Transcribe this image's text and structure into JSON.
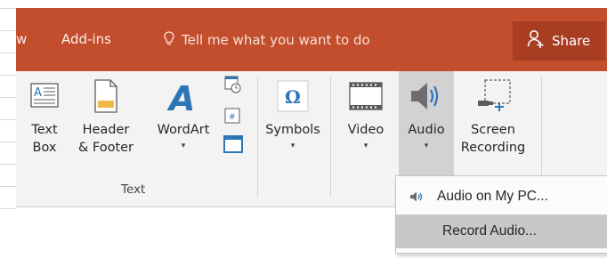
{
  "tabs": {
    "partial_tab": "w",
    "addins": "Add-ins",
    "tell_me": "Tell me what you want to do",
    "share": "Share"
  },
  "ribbon": {
    "text_box": {
      "line1": "Text",
      "line2": "Box"
    },
    "header_footer": {
      "line1": "Header",
      "line2": "& Footer"
    },
    "wordart": {
      "line1": "WordArt",
      "drop": "▾"
    },
    "symbols": {
      "line1": "Symbols",
      "drop": "▾",
      "glyph": "Ω"
    },
    "video": {
      "line1": "Video",
      "drop": "▾"
    },
    "audio": {
      "line1": "Audio",
      "drop": "▾"
    },
    "screen_recording": {
      "line1": "Screen",
      "line2": "Recording"
    },
    "text_group_label": "Text"
  },
  "audio_menu": {
    "items": [
      {
        "label": "Audio on My PC...",
        "icon": "speaker-icon"
      },
      {
        "label": "Record Audio..."
      }
    ]
  },
  "colors": {
    "tabbar": "#c24e2e",
    "share_bg": "#a83d22",
    "ribbon_bg": "#f3f3f3",
    "hover": "#c8c8c8"
  }
}
